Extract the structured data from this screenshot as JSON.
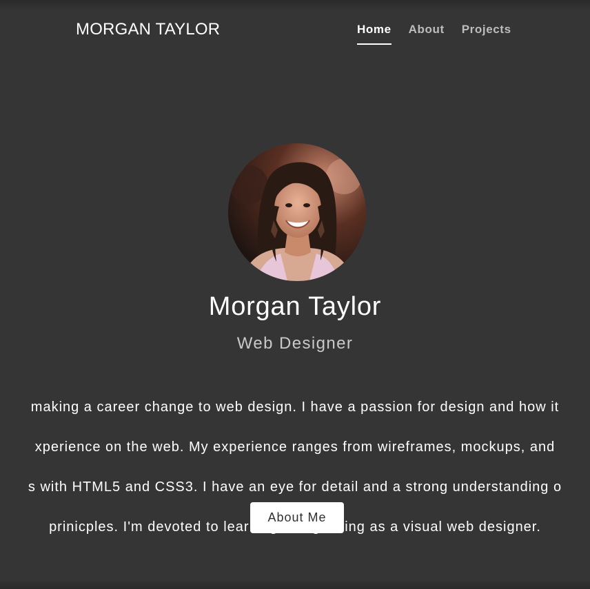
{
  "header": {
    "logo_text": "MORGAN TAYLOR",
    "nav": [
      {
        "label": "Home",
        "active": true
      },
      {
        "label": "About",
        "active": false
      },
      {
        "label": "Projects",
        "active": false
      }
    ]
  },
  "hero": {
    "name": "Morgan Taylor",
    "role": "Web Designer",
    "bio_lines": [
      "making a career change to web design. I have a passion for design and how it",
      "xperience on the web. My experience ranges from wireframes, mockups, and",
      "s with HTML5 and CSS3. I have an eye for detail and a strong understanding o",
      "prinicples. I'm devoted to learning and growing as a visual web designer."
    ],
    "button_label": "About Me"
  },
  "colors": {
    "background": "#353535",
    "text": "#ffffff",
    "nav_inactive": "#bdbdbd",
    "role_text": "#c9c9c9",
    "button_bg": "#ffffff",
    "button_text": "#2f2f2f"
  }
}
